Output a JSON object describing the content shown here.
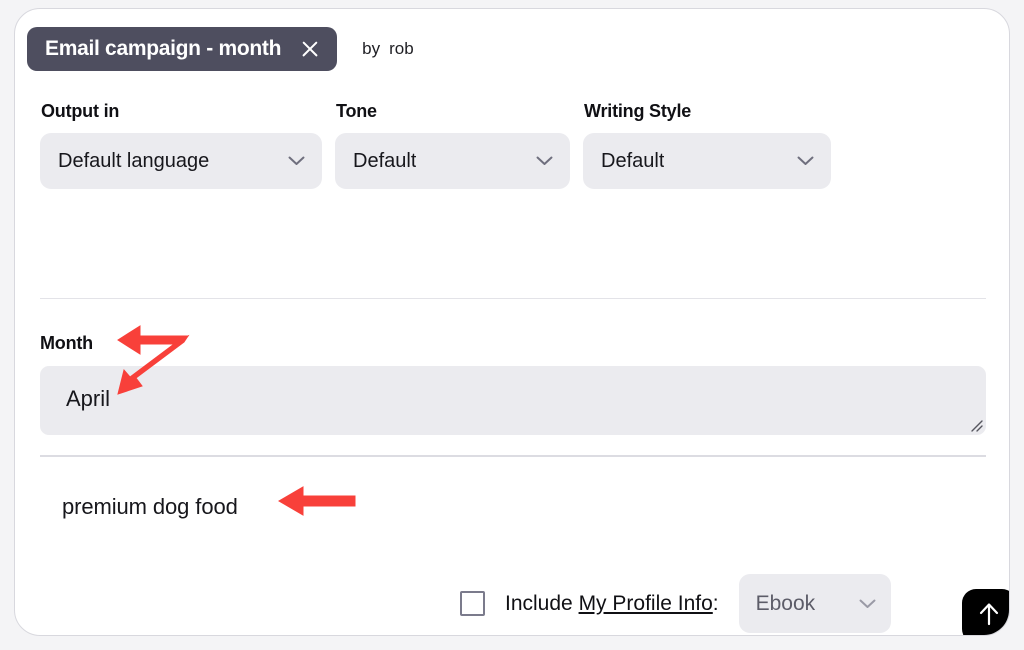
{
  "header": {
    "title": "Email campaign - month",
    "close_icon": "close-icon",
    "by_word": "by",
    "author": "rob"
  },
  "fields": [
    {
      "label": "Output in",
      "value": "Default language",
      "icon": "chevron-down-icon",
      "name": "output-language"
    },
    {
      "label": "Tone",
      "value": "Default",
      "icon": "chevron-down-icon",
      "name": "tone"
    },
    {
      "label": "Writing Style",
      "value": "Default",
      "icon": "chevron-down-icon",
      "name": "writing-style"
    }
  ],
  "month_section": {
    "label": "Month",
    "value": "April",
    "resize_icon": "resize-grip-icon"
  },
  "prompt": {
    "text": "premium dog food"
  },
  "bottom": {
    "include_prefix": "Include ",
    "profile_link": "My Profile Info",
    "include_suffix": ":",
    "ebook_value": "Ebook",
    "ebook_icon": "chevron-down-icon",
    "submit_icon": "arrow-up-icon"
  },
  "annotations": [
    {
      "name": "arrow-to-month-field",
      "color": "#f8403a",
      "style": "double-headed"
    },
    {
      "name": "arrow-to-prompt-text",
      "color": "#f8403a",
      "style": "single-headed"
    }
  ],
  "colors": {
    "chip_bg": "#4e4e5f",
    "field_bg": "#ebebef",
    "card_bg": "#ffffff",
    "page_bg": "#f4f4f6",
    "submit_bg": "#000000",
    "annotation_red": "#f8403a"
  }
}
